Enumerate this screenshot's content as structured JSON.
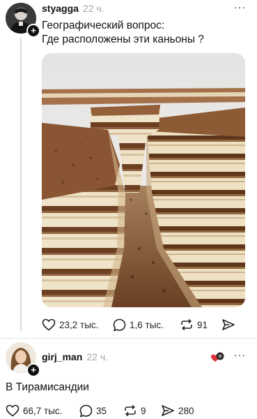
{
  "post": {
    "username": "styagga",
    "time": "22 ч.",
    "text_line1": "Географический вопрос:",
    "text_line2": "Где расположены эти каньоны ?",
    "likes": "23,2 тыс.",
    "comments": "1,6 тыс.",
    "reposts": "91"
  },
  "reply": {
    "username": "girj_man",
    "time": "22 ч.",
    "text": "В Тирамисандии",
    "likes": "66,7 тыс.",
    "comments": "35",
    "reposts": "9",
    "shares": "280"
  },
  "icons": {
    "like": "heart-icon",
    "comment": "comment-bubble-icon",
    "repost": "repost-icon",
    "share": "send-icon",
    "more": "more-dots-icon",
    "follow": "plus-icon"
  },
  "colors": {
    "text": "#111111",
    "muted": "#a3a3a3",
    "divider": "#e6e6e6",
    "thread": "#d9d9d9"
  }
}
